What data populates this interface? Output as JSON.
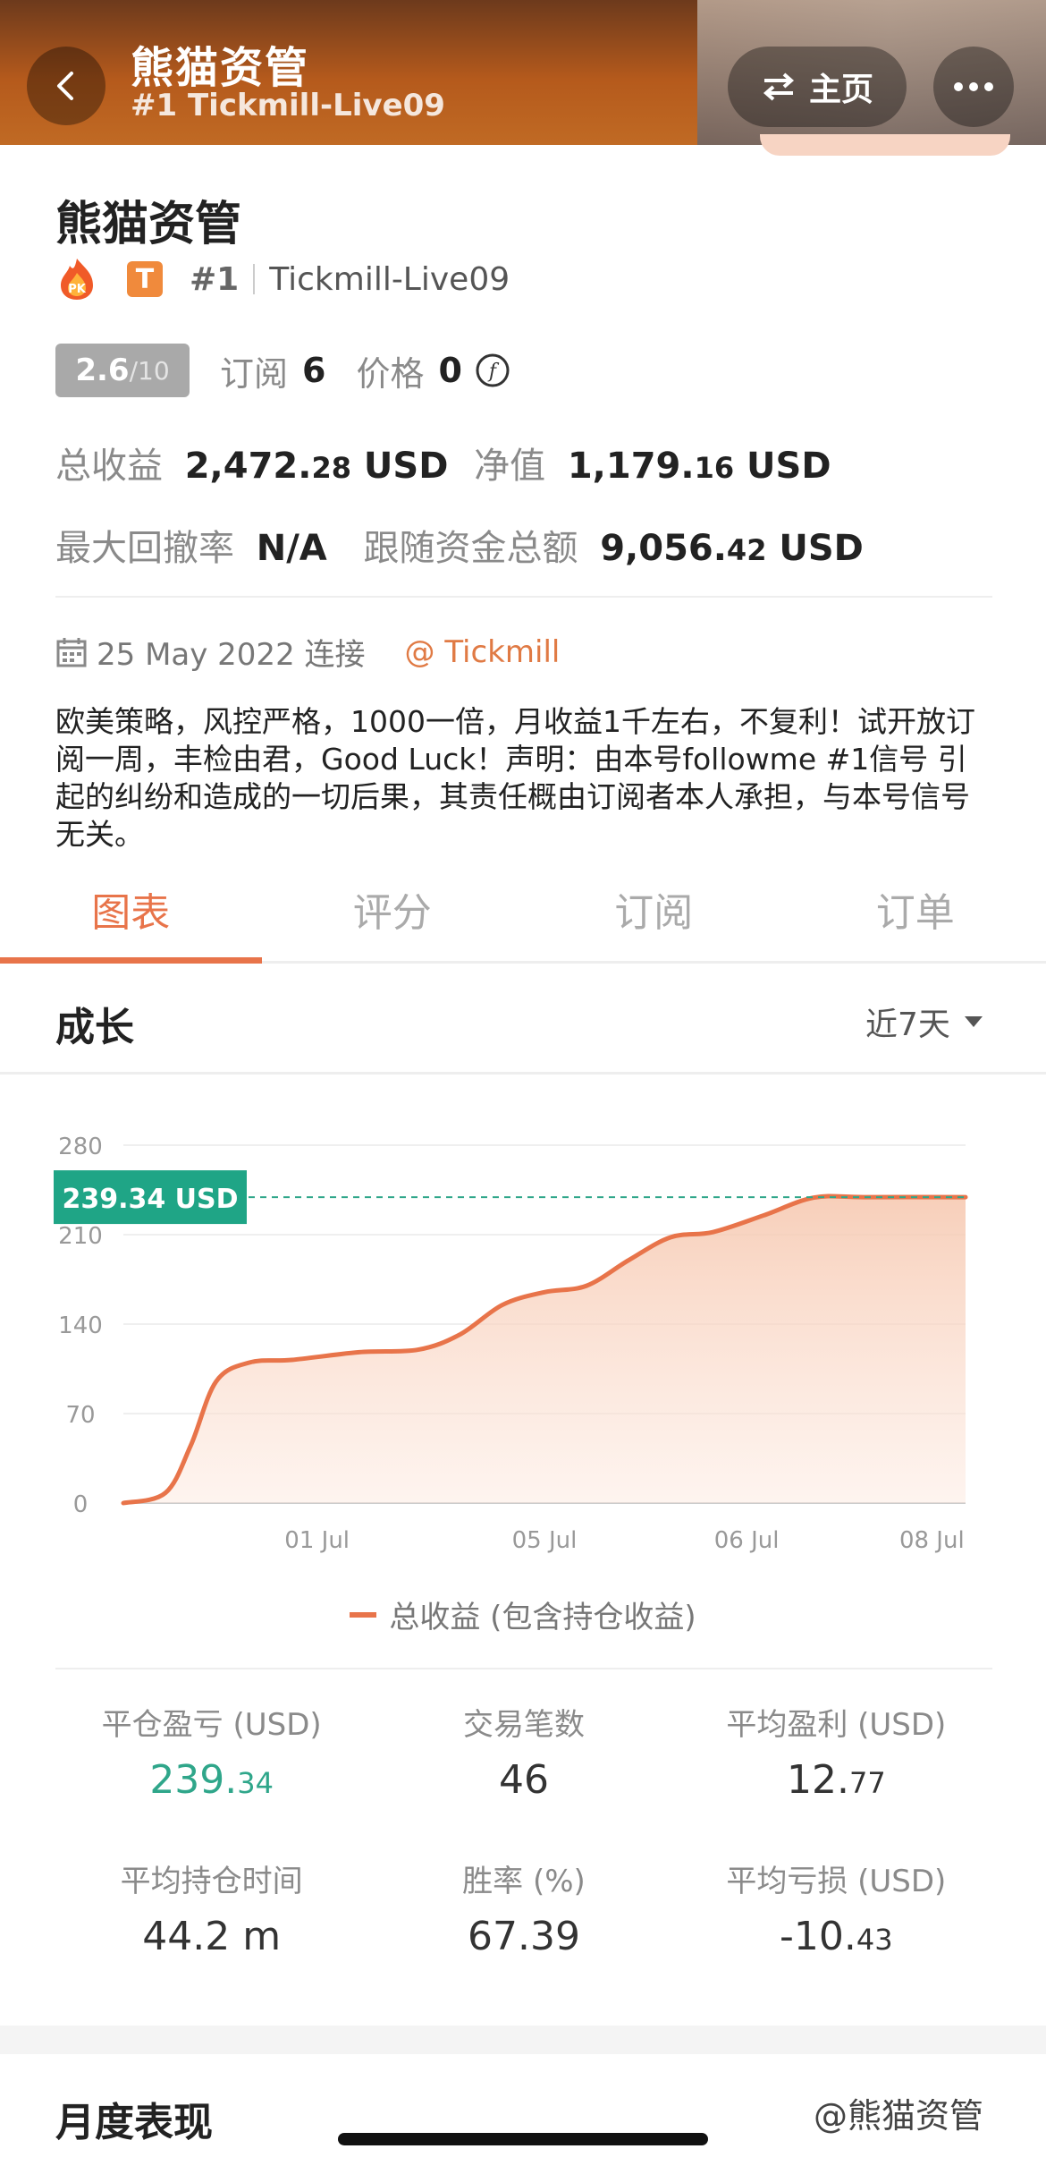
{
  "header": {
    "title": "熊猫资管",
    "subtitle": "#1 Tickmill-Live09",
    "home_label": "主页"
  },
  "profile": {
    "name": "熊猫资管",
    "rank": "#1",
    "server": "Tickmill-Live09",
    "score_num": "2.6",
    "score_den": "/10",
    "subscribe_label": "订阅",
    "subscribe_count": "6",
    "price_label": "价格",
    "price_value": "0",
    "total_profit_label": "总收益",
    "total_profit_int": "2,472.",
    "total_profit_dec": "28",
    "total_profit_unit": "USD",
    "equity_label": "净值",
    "equity_int": "1,179.",
    "equity_dec": "16",
    "equity_unit": "USD",
    "drawdown_label": "最大回撤率",
    "drawdown_value": "N/A",
    "follow_label": "跟随资金总额",
    "follow_int": "9,056.",
    "follow_dec": "42",
    "follow_unit": "USD",
    "connect_date": "25 May 2022 连接",
    "broker": "@ Tickmill",
    "description": "欧美策略，风控严格，1000一倍，月收益1千左右，不复利！试开放订阅一周，丰检由君，Good Luck！声明：由本号followme #1信号 引起的纠纷和造成的一切后果，其责任概由订阅者本人承担，与本号信号无关。"
  },
  "tabs": [
    "图表",
    "评分",
    "订阅",
    "订单"
  ],
  "growth": {
    "title": "成长",
    "range": "近7天"
  },
  "chart_data": {
    "type": "area",
    "title": "",
    "xlabel": "",
    "ylabel": "",
    "ylim": [
      0,
      280
    ],
    "yticks": [
      "280",
      "210",
      "140",
      "70",
      "0"
    ],
    "xticks": [
      {
        "label": "01 Jul",
        "x": 0.23
      },
      {
        "label": "05 Jul",
        "x": 0.5
      },
      {
        "label": "06 Jul",
        "x": 0.74
      },
      {
        "label": "08 Jul",
        "x": 0.96
      }
    ],
    "series": [
      {
        "name": "总收益 (包含持仓收益)",
        "color": "#e8744a",
        "x": [
          0.0,
          0.05,
          0.08,
          0.11,
          0.15,
          0.2,
          0.28,
          0.35,
          0.4,
          0.45,
          0.5,
          0.55,
          0.6,
          0.65,
          0.7,
          0.76,
          0.82,
          0.88,
          1.0
        ],
        "y": [
          0,
          8,
          45,
          95,
          110,
          112,
          118,
          120,
          132,
          155,
          165,
          170,
          190,
          208,
          212,
          225,
          239,
          239.34,
          239.34
        ]
      }
    ],
    "current_label": "239.34 USD",
    "current_value": 239.34
  },
  "legend_label": "总收益 (包含持仓收益)",
  "stats": [
    {
      "label": "平仓盈亏 (USD)",
      "int": "239.",
      "dec": "34",
      "green": true
    },
    {
      "label": "交易笔数",
      "int": "46",
      "dec": "",
      "green": false
    },
    {
      "label": "平均盈利 (USD)",
      "int": "12.",
      "dec": "77",
      "green": false
    },
    {
      "label": "平均持仓时间",
      "int": "44.2 m",
      "dec": "",
      "green": false
    },
    {
      "label": "胜率 (%)",
      "int": "67.39",
      "dec": "",
      "green": false
    },
    {
      "label": "平均亏损 (USD)",
      "int": "-10.",
      "dec": "43",
      "green": false
    }
  ],
  "monthly_title": "月度表现",
  "watermark": "@熊猫资管",
  "colors": {
    "accent": "#e8744a",
    "green": "#1fa586"
  }
}
